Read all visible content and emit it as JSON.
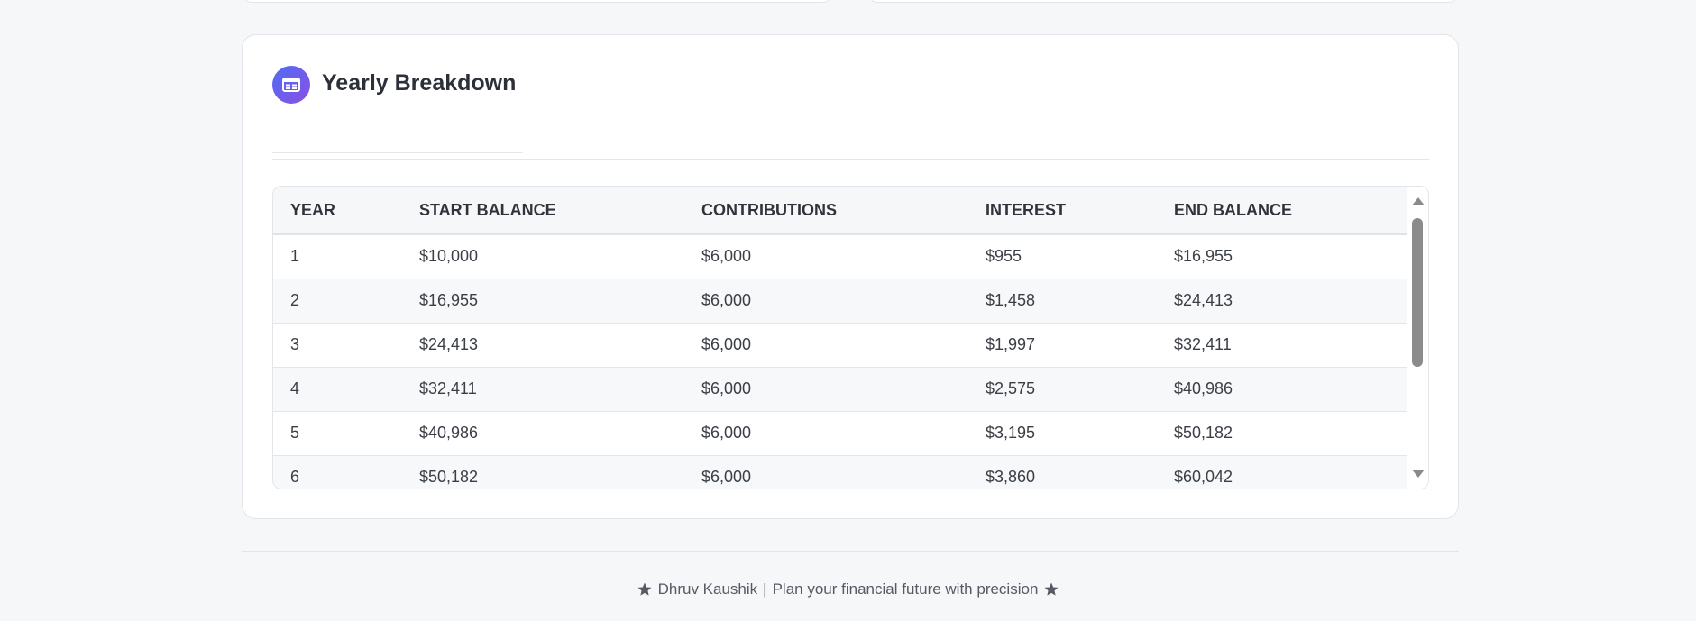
{
  "section": {
    "title": "Yearly Breakdown",
    "icon": "table-icon",
    "accent_gradient": [
      "#4f6ef2",
      "#8a4fe6"
    ]
  },
  "table": {
    "columns": [
      "YEAR",
      "START BALANCE",
      "CONTRIBUTIONS",
      "INTEREST",
      "END BALANCE"
    ],
    "rows": [
      [
        "1",
        "$10,000",
        "$6,000",
        "$955",
        "$16,955"
      ],
      [
        "2",
        "$16,955",
        "$6,000",
        "$1,458",
        "$24,413"
      ],
      [
        "3",
        "$24,413",
        "$6,000",
        "$1,997",
        "$32,411"
      ],
      [
        "4",
        "$32,411",
        "$6,000",
        "$2,575",
        "$40,986"
      ],
      [
        "5",
        "$40,986",
        "$6,000",
        "$3,195",
        "$50,182"
      ],
      [
        "6",
        "$50,182",
        "$6,000",
        "$3,860",
        "$60,042"
      ]
    ]
  },
  "footer": {
    "author": "Dhruv Kaushik",
    "separator": "|",
    "tagline": "Plan your financial future with precision",
    "icon": "star-icon"
  }
}
